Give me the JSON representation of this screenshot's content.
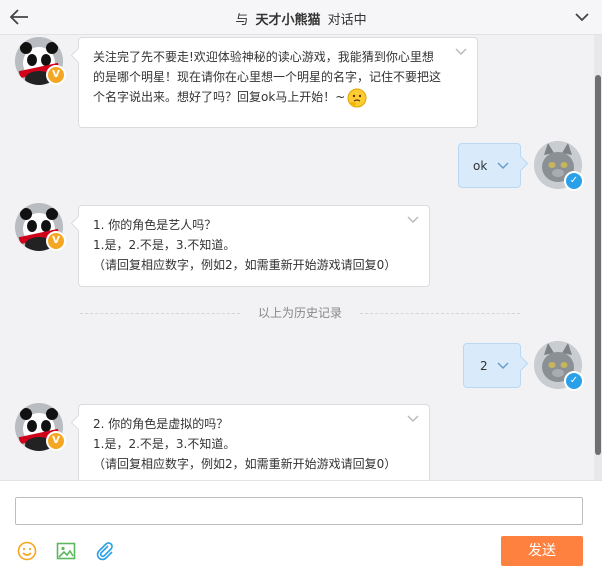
{
  "header": {
    "prefix": "与",
    "contact_name": "天才小熊猫",
    "suffix": "对话中"
  },
  "messages": [
    {
      "direction": "in",
      "lines": [
        "关注完了先不要走!欢迎体验神秘的读心游戏，我能猜到你心里想",
        "的是哪个明星！现在请你在心里想一个明星的名字，记住不要把这",
        "个名字说出来。想好了吗？回复ok马上开始！~"
      ],
      "emoji": "thinking-face"
    },
    {
      "direction": "out",
      "text": "ok"
    },
    {
      "direction": "in",
      "lines": [
        "1. 你的角色是艺人吗？",
        "1.是，2.不是，3.不知道。",
        "（请回复相应数字，例如2，如需重新开始游戏请回复0）"
      ]
    },
    {
      "direction": "out",
      "text": "2"
    },
    {
      "direction": "in",
      "lines": [
        "2. 你的角色是虚拟的吗？",
        "1.是，2.不是，3.不知道。",
        "（请回复相应数字，例如2，如需重新开始游戏请回复0）"
      ]
    }
  ],
  "history_divider": "以上为历史记录",
  "badges": {
    "contact": "V",
    "user": "✓"
  },
  "composer": {
    "input_value": "",
    "send_label": "发送",
    "tools": [
      "emoji-icon",
      "image-icon",
      "attachment-icon"
    ]
  },
  "colors": {
    "accent": "#ff8140",
    "badge_orange": "#f5a623",
    "badge_blue": "#2aa0e8",
    "tool_orange": "#f5a623",
    "tool_green": "#5cb85c",
    "tool_blue": "#2aa0e8"
  }
}
